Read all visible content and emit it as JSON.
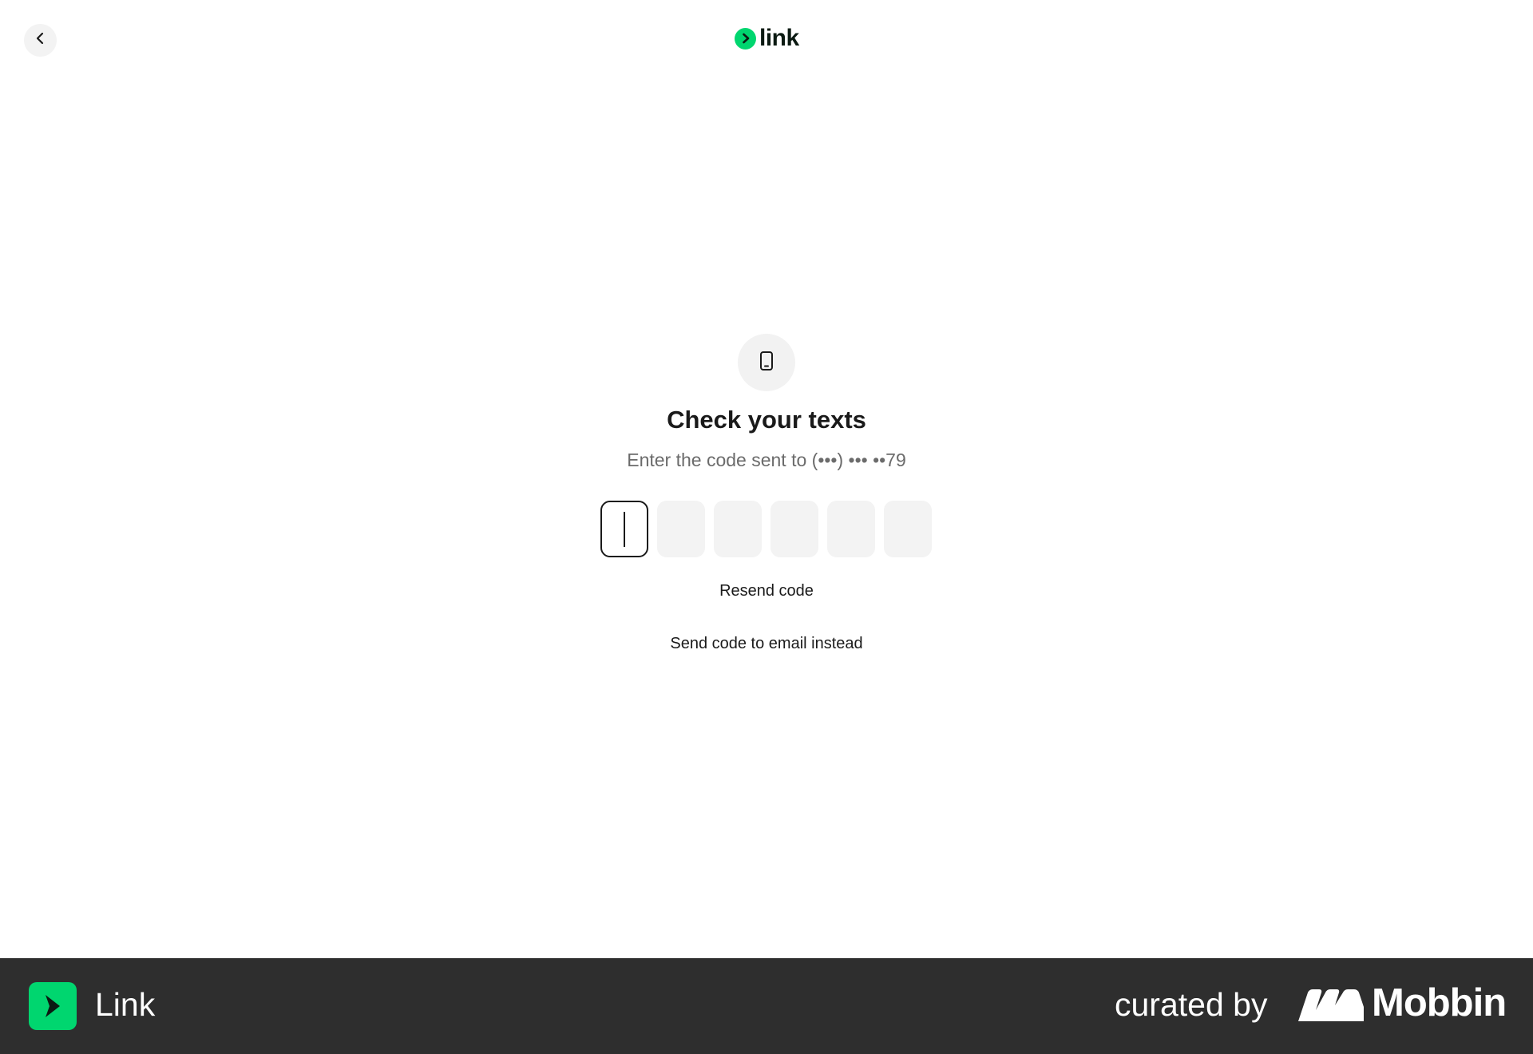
{
  "header": {
    "back_icon": "chevron-left-icon",
    "logo_text": "link",
    "logo_icon": "chevron-right-icon",
    "accent_color": "#00d66f"
  },
  "main": {
    "icon": "smartphone-icon",
    "title": "Check your texts",
    "subtitle": "Enter the code sent to (•••) ••• ••79",
    "code_inputs": [
      {
        "value": "",
        "active": true
      },
      {
        "value": "",
        "active": false
      },
      {
        "value": "",
        "active": false
      },
      {
        "value": "",
        "active": false
      },
      {
        "value": "",
        "active": false
      },
      {
        "value": "",
        "active": false
      }
    ],
    "resend_label": "Resend code",
    "email_instead_label": "Send code to email instead"
  },
  "footer": {
    "app_icon": "link-app-icon",
    "app_name": "Link",
    "curated_label": "curated by",
    "brand_name": "Mobbin",
    "brand_icon": "mobbin-logo-icon",
    "background_color": "#2e2e2e"
  }
}
